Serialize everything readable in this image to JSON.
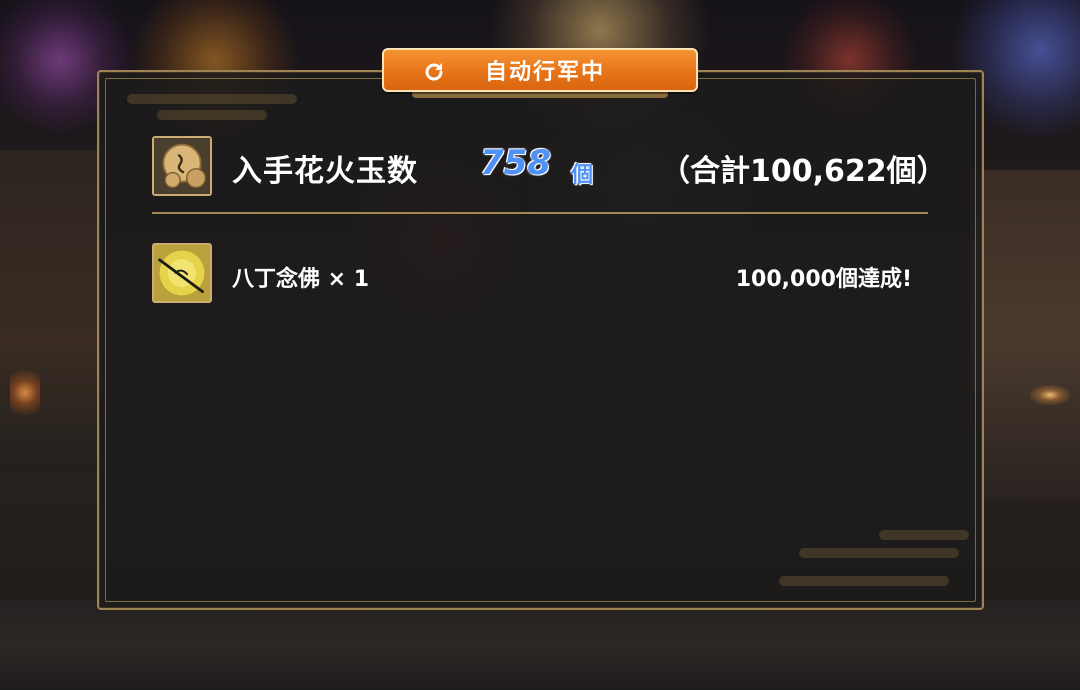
{
  "status_banner": {
    "label": "自动行军中",
    "icon": "refresh-icon",
    "color": "#e87418"
  },
  "reward_summary": {
    "title": "入手花火玉数",
    "count": "758",
    "unit": "個",
    "total": "（合計100,622個）",
    "icon": "firework-ball-icon",
    "count_color": "#4f91f6"
  },
  "reward_items": [
    {
      "name": "八丁念佛 × 1",
      "achievement": "100,000個達成!",
      "icon": "sword-icon"
    }
  ],
  "colors": {
    "panel_border": "#9d8452",
    "panel_bg": "#1c1b1b"
  }
}
